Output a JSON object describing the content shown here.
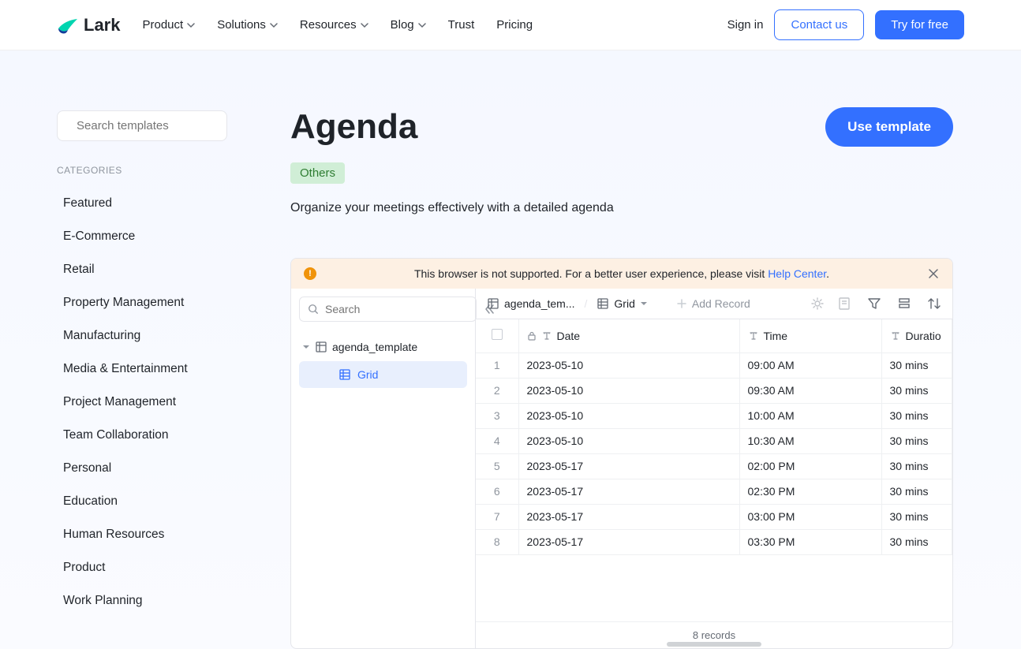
{
  "header": {
    "logo": "Lark",
    "nav": {
      "product": "Product",
      "solutions": "Solutions",
      "resources": "Resources",
      "blog": "Blog",
      "trust": "Trust",
      "pricing": "Pricing"
    },
    "signin": "Sign in",
    "contact": "Contact us",
    "tryfree": "Try for free"
  },
  "sidebar": {
    "search_placeholder": "Search templates",
    "categories_label": "CATEGORIES",
    "categories": [
      "Featured",
      "E-Commerce",
      "Retail",
      "Property Management",
      "Manufacturing",
      "Media & Entertainment",
      "Project Management",
      "Team Collaboration",
      "Personal",
      "Education",
      "Human Resources",
      "Product",
      "Work Planning"
    ]
  },
  "content": {
    "title": "Agenda",
    "use_template": "Use template",
    "tag": "Others",
    "description": "Organize your meetings effectively with a detailed agenda"
  },
  "preview": {
    "warning": {
      "text_a": "This browser is not supported. For a better user experience, please visit ",
      "link": "Help Center",
      "text_b": "."
    },
    "sidebar": {
      "search_placeholder": "Search",
      "tree_root": "agenda_template",
      "tree_child": "Grid"
    },
    "toolbar": {
      "table_name": "agenda_tem...",
      "view_name": "Grid",
      "add_record": "Add Record"
    },
    "table": {
      "columns": {
        "date": "Date",
        "time": "Time",
        "duration": "Duratio"
      },
      "rows": [
        {
          "n": "1",
          "date": "2023-05-10",
          "time": "09:00 AM",
          "dur": "30 mins"
        },
        {
          "n": "2",
          "date": "2023-05-10",
          "time": "09:30 AM",
          "dur": "30 mins"
        },
        {
          "n": "3",
          "date": "2023-05-10",
          "time": "10:00 AM",
          "dur": "30 mins"
        },
        {
          "n": "4",
          "date": "2023-05-10",
          "time": "10:30 AM",
          "dur": "30 mins"
        },
        {
          "n": "5",
          "date": "2023-05-17",
          "time": "02:00 PM",
          "dur": "30 mins"
        },
        {
          "n": "6",
          "date": "2023-05-17",
          "time": "02:30 PM",
          "dur": "30 mins"
        },
        {
          "n": "7",
          "date": "2023-05-17",
          "time": "03:00 PM",
          "dur": "30 mins"
        },
        {
          "n": "8",
          "date": "2023-05-17",
          "time": "03:30 PM",
          "dur": "30 mins"
        }
      ],
      "footer": "8 records"
    }
  }
}
